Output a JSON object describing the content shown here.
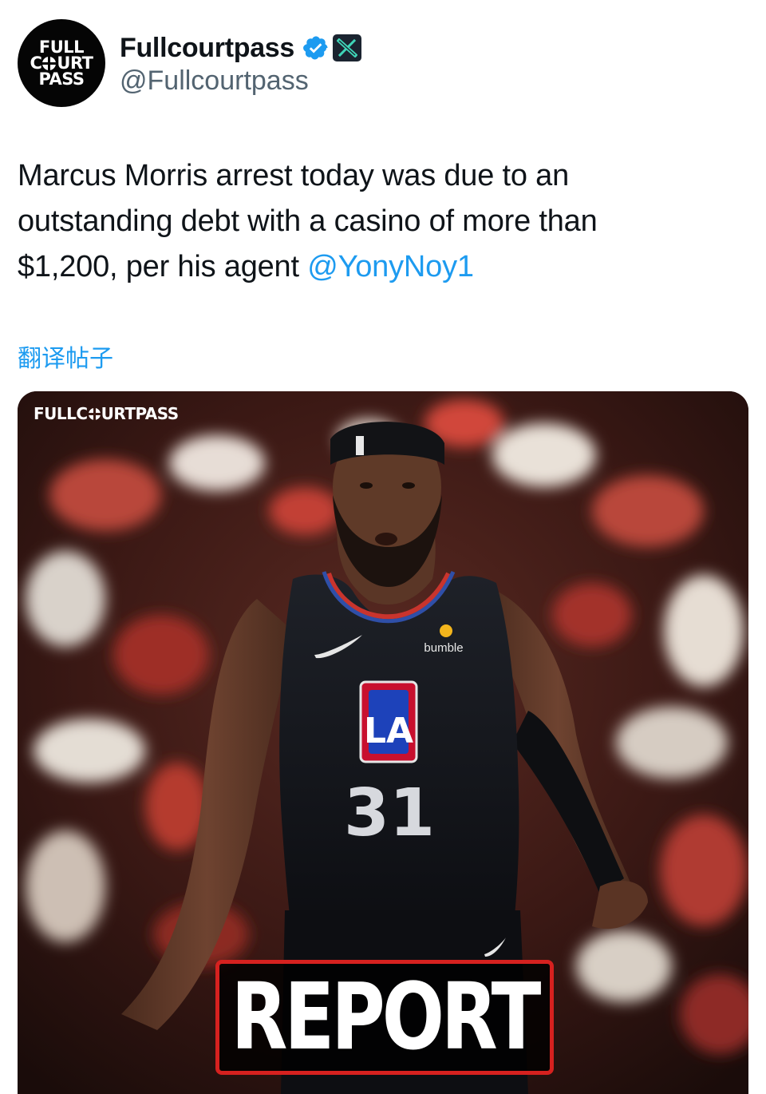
{
  "header": {
    "avatar": {
      "lines": [
        "FULL",
        "C",
        "URT",
        "PASS"
      ]
    },
    "display_name": "Fullcourtpass",
    "handle": "@Fullcourtpass",
    "verified_icon": "verified-check-icon",
    "affiliate_icon": "x-logo-icon",
    "verified_color": "#1d9bf0"
  },
  "tweet": {
    "line1": "Marcus Morris arrest today was due to an",
    "line2": "outstanding debt with a casino of more than",
    "line3_text": "$1,200, per his agent ",
    "mention": "@YonyNoy1",
    "translate_label": "翻译帖子"
  },
  "media": {
    "watermark_pre": "FULLC",
    "watermark_post": "URTPASS",
    "jersey_sponsor": "bumble",
    "jersey_logo": "LA",
    "jersey_number": "31",
    "banner_text": "REPORT",
    "banner_color": "#d6211f"
  },
  "colors": {
    "text": "#0f1419",
    "secondary": "#536471",
    "link": "#1d9bf0"
  }
}
